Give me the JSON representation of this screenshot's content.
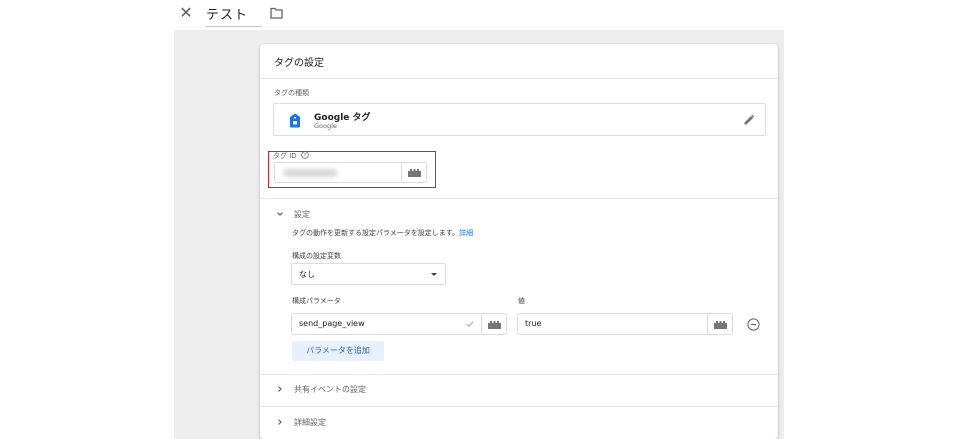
{
  "header": {
    "title": "テスト"
  },
  "card": {
    "title": "タグの設定",
    "tag_type": {
      "label": "タグの種類",
      "name": "Google タグ",
      "provider": "Google"
    },
    "tag_id": {
      "label": "タグ ID"
    },
    "settings": {
      "label": "設定",
      "description": "タグの動作を更新する設定パラメータを設定します。",
      "details_link": "詳細",
      "config_variable": {
        "label": "構成の設定変数",
        "value": "なし"
      },
      "parameter": {
        "name_label": "構成パラメータ",
        "value_label": "値",
        "name": "send_page_view",
        "value": "true"
      },
      "add_parameter_button": "パラメータを追加"
    },
    "shared_event_settings": {
      "label": "共有イベントの設定"
    },
    "advanced_settings": {
      "label": "詳細設定"
    }
  },
  "colors": {
    "accent": "#1a73e8",
    "highlight_border": "#c62828",
    "canvas": "#eeeeee"
  }
}
